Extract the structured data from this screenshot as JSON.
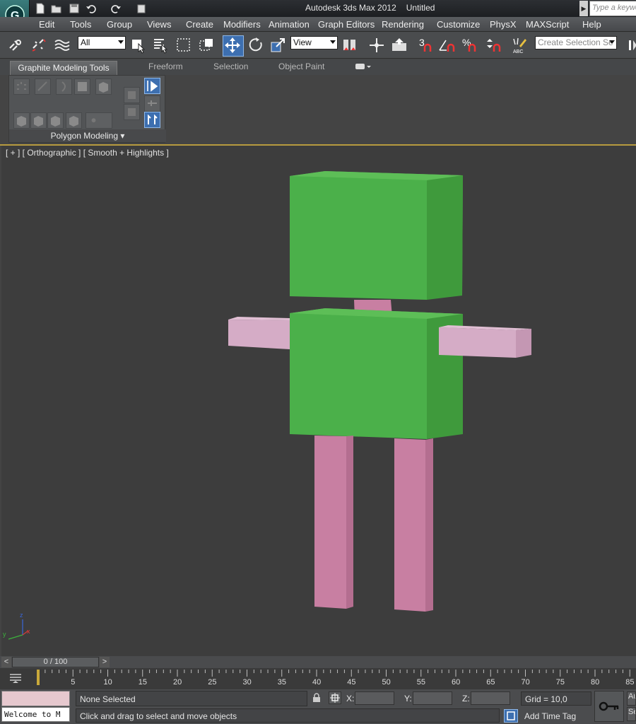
{
  "window": {
    "app_title": "Autodesk 3ds Max  2012",
    "doc_title": "Untitled",
    "search_placeholder": "Type a keyword"
  },
  "menu": [
    "Edit",
    "Tools",
    "Group",
    "Views",
    "Create",
    "Modifiers",
    "Animation",
    "Graph Editors",
    "Rendering",
    "Customize",
    "PhysX",
    "MAXScript",
    "Help"
  ],
  "toolbar": {
    "selection_filter": "All",
    "reference_coord": "View",
    "named_selection_placeholder": "Create Selection Se"
  },
  "ribbon": {
    "tabs": [
      "Graphite Modeling Tools",
      "Freeform",
      "Selection",
      "Object Paint"
    ],
    "panel_label": "Polygon Modeling ▾"
  },
  "viewport": {
    "label": "[ + ] [ Orthographic ] [ Smooth + Highlights ]",
    "axis_labels": {
      "x": "x",
      "y": "y",
      "z": "z"
    },
    "colors": {
      "body": "#4bb04a",
      "limbs": "#c87fa2",
      "arms": "#d5acc6",
      "background": "#3d3d3d"
    }
  },
  "timeline": {
    "slider_text": "0 / 100",
    "ticks": [
      "5",
      "10",
      "15",
      "20",
      "25",
      "30",
      "35",
      "40",
      "45",
      "50",
      "55",
      "60",
      "65",
      "70",
      "75",
      "80",
      "85"
    ]
  },
  "status": {
    "listener_text": "Welcome to M",
    "selection": "None Selected",
    "prompt": "Click and drag to select and move objects",
    "coord_x": "X:",
    "coord_y": "Y:",
    "coord_z": "Z:",
    "grid": "Grid = 10,0",
    "add_time_tag": "Add Time Tag",
    "autokey_cut1": "Au",
    "autokey_cut2": "Se"
  }
}
